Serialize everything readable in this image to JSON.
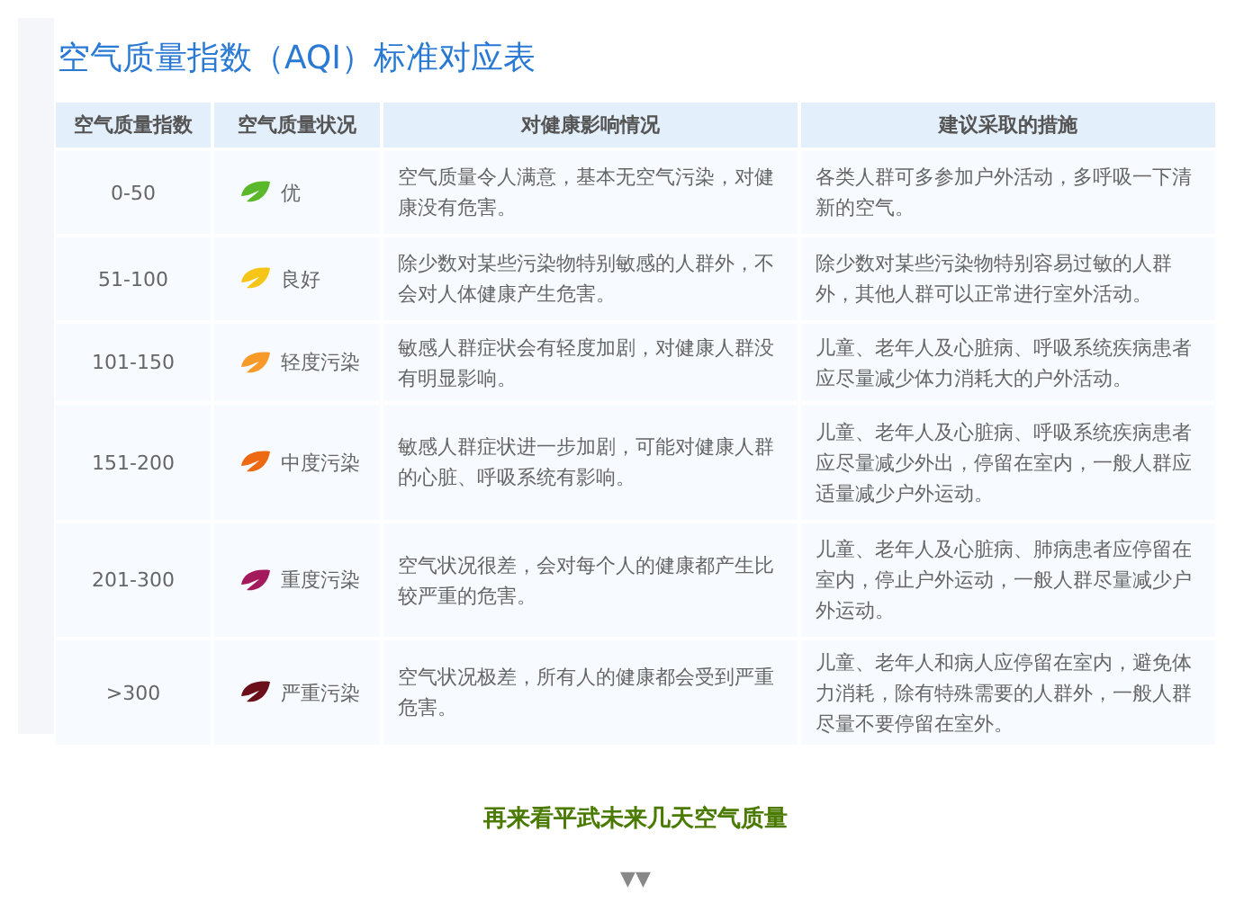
{
  "title": "空气质量指数（AQI）标准对应表",
  "table": {
    "columns": [
      "空气质量指数",
      "空气质量状况",
      "对健康影响情况",
      "建议采取的措施"
    ],
    "rows": [
      {
        "index": "0-50",
        "level": "优",
        "color": "#5bb82a",
        "health": "空气质量令人满意，基本无空气污染，对健康没有危害。",
        "advice": "各类人群可多参加户外活动，多呼吸一下清新的空气。"
      },
      {
        "index": "51-100",
        "level": "良好",
        "color": "#f5c518",
        "health": "除少数对某些污染物特别敏感的人群外，不会对人体健康产生危害。",
        "advice": "除少数对某些污染物特别容易过敏的人群外，其他人群可以正常进行室外活动。"
      },
      {
        "index": "101-150",
        "level": "轻度污染",
        "color": "#f79a2a",
        "health": "敏感人群症状会有轻度加剧，对健康人群没有明显影响。",
        "advice": "儿童、老年人及心脏病、呼吸系统疾病患者应尽量减少体力消耗大的户外活动。"
      },
      {
        "index": "151-200",
        "level": "中度污染",
        "color": "#ee6a12",
        "health": "敏感人群症状进一步加剧，可能对健康人群的心脏、呼吸系统有影响。",
        "advice": "儿童、老年人及心脏病、呼吸系统疾病患者应尽量减少外出，停留在室内，一般人群应适量减少户外运动。"
      },
      {
        "index": "201-300",
        "level": "重度污染",
        "color": "#a3195b",
        "health": "空气状况很差，会对每个人的健康都产生比较严重的危害。",
        "advice": "儿童、老年人及心脏病、肺病患者应停留在室内，停止户外运动，一般人群尽量减少户外运动。"
      },
      {
        "index": ">300",
        "level": "严重污染",
        "color": "#6b0f1a",
        "health": "空气状况极差，所有人的健康都会受到严重危害。",
        "advice": "儿童、老年人和病人应停留在室内，避免体力消耗，除有特殊需要的人群外，一般人群尽量不要停留在室外。"
      }
    ]
  },
  "footer": "再来看平武未来几天空气质量",
  "arrows": "▼▼"
}
